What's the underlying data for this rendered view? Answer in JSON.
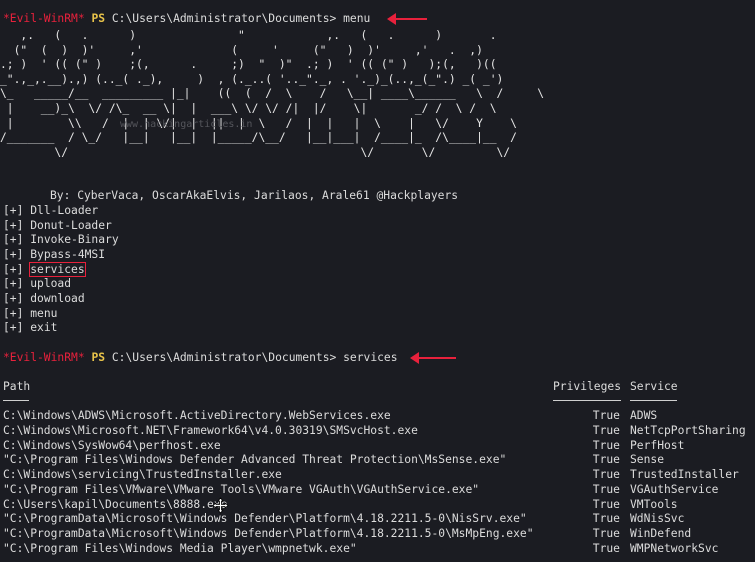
{
  "prompt1": {
    "tag": "*Evil-WinRM*",
    "ps": "PS",
    "path": "C:\\Users\\Administrator\\Documents>",
    "command": "menu"
  },
  "banner": {
    "art": "   ,.   (   .      )               \"            ,.   (   .      )       .\n  (\"  (  )  )'     ,'             (     '     (\"   )  )'     ,'   .  ,)\n.; )  ' (( (\" )    ;(,      .     ;)  \"  )\"  .; )  ' (( (\" )   );(,   )((\n_\".,_,.__).,) (.._( ._),     )  , (._..( '.._\"._, . '._)_(..,_(_\".) _( _')\n\\_   _____/__  _________ |_|    ((  (  /  \\    /   \\__| ____\\______   \\  /     \\\n |    __)_\\  \\/ /\\_  __ \\|  |  ___\\ \\/ \\/ /|  |/    \\|       _/ /  \\ /  \\\n |        \\\\   /  |  | \\/|  |  ||  |  \\   /  |  |   |  \\    |   \\/    Y    \\\n/_______  / \\_/   |__|   |__|  |_____/\\__/   |__|___|  /____|_  /\\____|__  /\n        \\/                                           \\/       \\/         \\/",
    "watermark": "www.hackingarticles.in"
  },
  "credits": "By: CyberVaca, OscarAkaElvis, Jarilaos, Arale61 @Hackplayers",
  "menu_items": [
    {
      "prefix": "[+]",
      "label": "Dll-Loader"
    },
    {
      "prefix": "[+]",
      "label": "Donut-Loader"
    },
    {
      "prefix": "[+]",
      "label": "Invoke-Binary"
    },
    {
      "prefix": "[+]",
      "label": "Bypass-4MSI"
    },
    {
      "prefix": "[+]",
      "label": "services"
    },
    {
      "prefix": "[+]",
      "label": "upload"
    },
    {
      "prefix": "[+]",
      "label": "download"
    },
    {
      "prefix": "[+]",
      "label": "menu"
    },
    {
      "prefix": "[+]",
      "label": "exit"
    }
  ],
  "prompt2": {
    "tag": "*Evil-WinRM*",
    "ps": "PS",
    "path": "C:\\Users\\Administrator\\Documents>",
    "command": "services"
  },
  "table": {
    "headers": {
      "path": "Path",
      "privileges": "Privileges",
      "service": "Service"
    },
    "rows": [
      {
        "path": "C:\\Windows\\ADWS\\Microsoft.ActiveDirectory.WebServices.exe",
        "privileges": "True",
        "service": "ADWS"
      },
      {
        "path": "C:\\Windows\\Microsoft.NET\\Framework64\\v4.0.30319\\SMSvcHost.exe",
        "privileges": "True",
        "service": "NetTcpPortSharing"
      },
      {
        "path": "C:\\Windows\\SysWow64\\perfhost.exe",
        "privileges": "True",
        "service": "PerfHost"
      },
      {
        "path": "\"C:\\Program Files\\Windows Defender Advanced Threat Protection\\MsSense.exe\"",
        "privileges": "True",
        "service": "Sense"
      },
      {
        "path": "C:\\Windows\\servicing\\TrustedInstaller.exe",
        "privileges": "True",
        "service": "TrustedInstaller"
      },
      {
        "path": "\"C:\\Program Files\\VMware\\VMware Tools\\VMware VGAuth\\VGAuthService.exe\"",
        "privileges": "True",
        "service": "VGAuthService"
      },
      {
        "path": "C:\\Users\\kapil\\Documents\\8888.exe",
        "privileges": "True",
        "service": "VMTools"
      },
      {
        "path": "\"C:\\ProgramData\\Microsoft\\Windows Defender\\Platform\\4.18.2211.5-0\\NisSrv.exe\"",
        "privileges": "True",
        "service": "WdNisSvc"
      },
      {
        "path": "\"C:\\ProgramData\\Microsoft\\Windows Defender\\Platform\\4.18.2211.5-0\\MsMpEng.exe\"",
        "privileges": "True",
        "service": "WinDefend"
      },
      {
        "path": "\"C:\\Program Files\\Windows Media Player\\wmpnetwk.exe\"",
        "privileges": "True",
        "service": "WMPNetworkSvc"
      }
    ]
  },
  "colors": {
    "background": "#1b1c22",
    "prompt_tag": "#e8213c",
    "ps": "#e8c34a",
    "highlight_box": "#e8213c",
    "arrow": "#e8213c"
  },
  "icons": {
    "cursor": "move-cursor-icon",
    "arrow": "red-arrow-icon"
  }
}
